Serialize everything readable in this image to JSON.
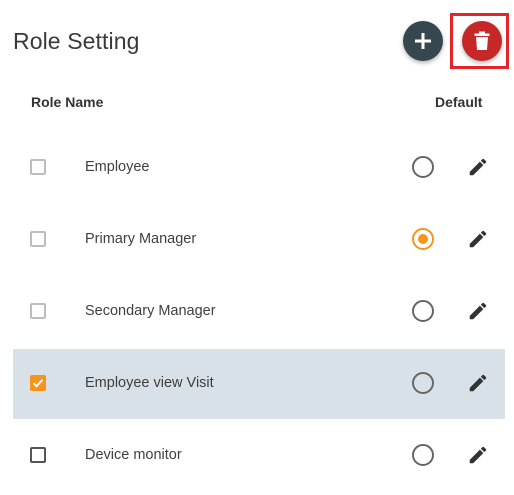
{
  "header": {
    "title": "Role Setting",
    "add_icon": "plus-icon",
    "delete_icon": "trash-icon"
  },
  "columns": {
    "role_name": "Role Name",
    "default": "Default"
  },
  "roles": [
    {
      "name": "Employee",
      "checked": false,
      "default": false,
      "selected": false
    },
    {
      "name": "Primary Manager",
      "checked": false,
      "default": true,
      "selected": false
    },
    {
      "name": "Secondary Manager",
      "checked": false,
      "default": false,
      "selected": false
    },
    {
      "name": "Employee view Visit",
      "checked": true,
      "default": false,
      "selected": true
    },
    {
      "name": "Device monitor",
      "checked": false,
      "default": false,
      "selected": false
    }
  ],
  "colors": {
    "accent": "#f7941d",
    "add_button": "#37474f",
    "delete_button": "#c62828",
    "highlight_box": "#e3242b",
    "selected_row": "#d8e0e8"
  }
}
